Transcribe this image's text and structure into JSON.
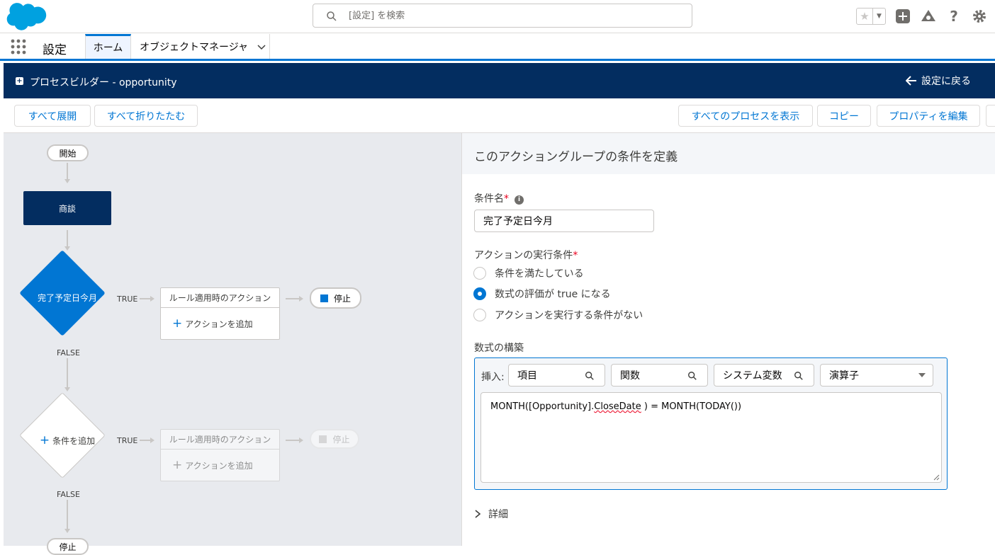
{
  "search": {
    "placeholder": "[設定] を検索"
  },
  "nav": {
    "app_name": "設定",
    "tab_home": "ホーム",
    "tab_object_manager": "オブジェクトマネージャ"
  },
  "header": {
    "title": "プロセスビルダー - opportunity",
    "back_label": "設定に戻る"
  },
  "toolbar": {
    "expand_all": "すべて展開",
    "collapse_all": "すべて折りたたむ",
    "view_all_processes": "すべてのプロセスを表示",
    "copy": "コピー",
    "edit_properties": "プロパティを編集"
  },
  "canvas": {
    "start": "開始",
    "object_node": "商談",
    "criteria1": "完了予定日今月",
    "true_label": "TRUE",
    "false_label": "FALSE",
    "immediate_actions": "ルール適用時のアクション",
    "add_action": "アクションを追加",
    "stop": "停止",
    "add_criteria": "条件を追加"
  },
  "panel": {
    "title": "このアクショングループの条件を定義",
    "criteria_name_label": "条件名",
    "criteria_name_value": "完了予定日今月",
    "execute_label": "アクションの実行条件",
    "radio_options": [
      "条件を満たしている",
      "数式の評価が true になる",
      "アクションを実行する条件がない"
    ],
    "selected_option_index": 1,
    "formula_label": "数式の構築",
    "insert_label": "挿入:",
    "pick_field": "項目",
    "pick_function": "関数",
    "pick_system_var": "システム変数",
    "pick_operator": "演算子",
    "formula_part1": "MONTH([Opportunity].",
    "formula_part2": "CloseDate",
    "formula_part3": " ) = MONTH(TODAY())",
    "details": "詳細"
  },
  "colors": {
    "brand_blue": "#0176d3",
    "header_navy": "#032d60",
    "node_navy": "#032d60"
  }
}
